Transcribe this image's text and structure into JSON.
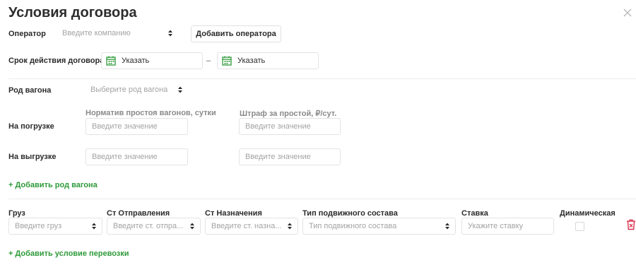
{
  "dialog": {
    "title": "Условия договора"
  },
  "operator": {
    "label": "Оператор",
    "company_placeholder": "Введите компанию",
    "add_button": "Добавить оператора"
  },
  "contract_term": {
    "label": "Срок действия договора",
    "from_text": "Указать",
    "separator": "–",
    "to_text": "Указать"
  },
  "wagon_kind": {
    "label": "Род вагона",
    "placeholder": "Выберите род вагона"
  },
  "loading": {
    "label": "На погрузке",
    "norm_caption": "Норматив простоя вагонов, сутки",
    "penalty_caption": "Штраф за простой, ₽/сут.",
    "norm_placeholder": "Введите значение",
    "penalty_placeholder": "Введите значение"
  },
  "unloading": {
    "label": "На выгрузке",
    "norm_placeholder": "Введите значение",
    "penalty_placeholder": "Введите значение"
  },
  "add_wagon_kind": "Добавить род вагона",
  "transport": {
    "headers": {
      "cargo": "Груз",
      "departure": "Ст Отправления",
      "destination": "Ст Назначения",
      "rolling_stock": "Тип подвижного состава",
      "rate": "Ставка",
      "dynamic": "Динамическая"
    },
    "row": {
      "cargo_placeholder": "Введите груз",
      "departure_placeholder": "Введите ст. отпра...",
      "destination_placeholder": "Введите ст. назна...",
      "rolling_stock_placeholder": "Тип подвижного состава",
      "rate_placeholder": "Укажите ставку"
    }
  },
  "add_transport_condition": "Добавить условие перевозки",
  "colors": {
    "accent_green": "#2e9a3a",
    "delete_red": "#d9304f"
  }
}
